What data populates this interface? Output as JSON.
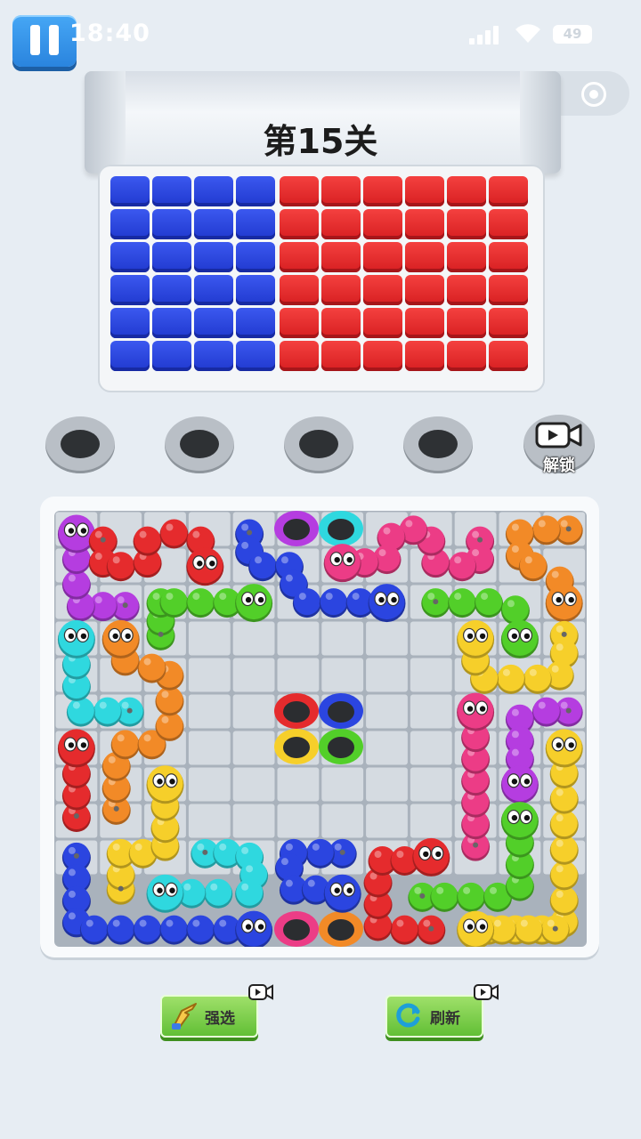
{
  "status_bar": {
    "time": "18:40",
    "battery": "49"
  },
  "level": {
    "title": "第15关"
  },
  "colors": {
    "blue": "#2b45e0",
    "red": "#e52b2d",
    "magenta": "#b53de0",
    "green": "#52cf29",
    "pink": "#ec3c86",
    "orange": "#f28a27",
    "cyan": "#2fd8df",
    "yellow": "#f6cf2a"
  },
  "cube_tray": {
    "rows": 6,
    "blue_columns": 4,
    "red_columns": 6
  },
  "slots": {
    "empty_count": 4,
    "locked_label": "解锁"
  },
  "board": {
    "grid": {
      "cols": 12,
      "rows": 10
    },
    "holes": [
      "magenta",
      "cyan",
      "red",
      "blue",
      "yellow",
      "green",
      "pink",
      "orange"
    ],
    "snakes": [
      {
        "color": "magenta",
        "direction": "head-up-left"
      },
      {
        "color": "red",
        "direction": "head-down"
      },
      {
        "color": "blue",
        "direction": "head-right"
      },
      {
        "color": "pink",
        "direction": "head-left"
      },
      {
        "color": "orange",
        "direction": "head-down"
      },
      {
        "color": "green",
        "direction": "head-right"
      },
      {
        "color": "green",
        "direction": "head-down"
      },
      {
        "color": "cyan",
        "direction": "head-up"
      },
      {
        "color": "orange",
        "direction": "head-up"
      },
      {
        "color": "yellow",
        "direction": "head-up"
      },
      {
        "color": "red",
        "direction": "head-up"
      },
      {
        "color": "pink",
        "direction": "head-up"
      },
      {
        "color": "magenta",
        "direction": "head-down"
      },
      {
        "color": "yellow",
        "direction": "head-up"
      },
      {
        "color": "green",
        "direction": "head-up"
      },
      {
        "color": "yellow",
        "direction": "head-up"
      },
      {
        "color": "cyan",
        "direction": "head-left"
      },
      {
        "color": "blue",
        "direction": "head-right"
      },
      {
        "color": "red",
        "direction": "head-right"
      },
      {
        "color": "blue",
        "direction": "head-right"
      },
      {
        "color": "yellow",
        "direction": "head-left"
      }
    ]
  },
  "buttons": {
    "force_select": {
      "label": "强选",
      "icon": "hand-pointer-icon",
      "has_video_ad": true
    },
    "refresh": {
      "label": "刷新",
      "icon": "refresh-icon",
      "has_video_ad": true
    }
  }
}
